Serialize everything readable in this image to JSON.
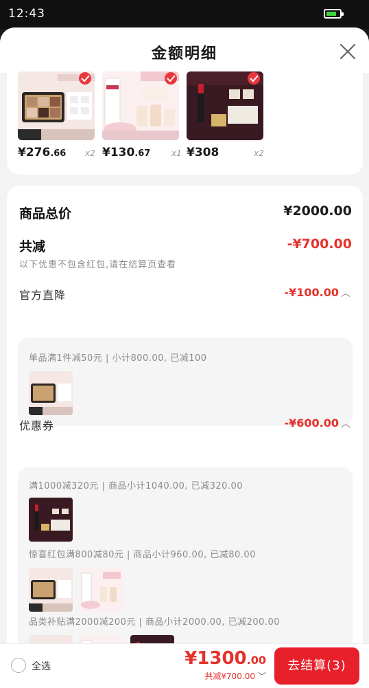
{
  "status_bar": {
    "time": "12:43",
    "battery_level": 0.8
  },
  "sheet": {
    "title": "金额明细"
  },
  "products": [
    {
      "price_main": "¥276",
      "price_dec": ".66",
      "qty": "x2"
    },
    {
      "price_main": "¥130",
      "price_dec": ".67",
      "qty": "x1"
    },
    {
      "price_main": "¥308",
      "price_dec": "",
      "qty": "x2"
    }
  ],
  "summary": {
    "total_label": "商品总价",
    "total_value": "¥2000.00",
    "discount_label": "共减",
    "discount_value": "-¥700.00",
    "discount_note": "以下优惠不包含红包,请在结算页查看"
  },
  "official": {
    "label": "官方直降",
    "value": "-¥100.00",
    "rule": "单品满1件减50元 | 小计800.00, 已减100"
  },
  "coupons": {
    "label": "优惠券",
    "value": "-¥600.00",
    "rules": [
      "满1000减320元 | 商品小计1040.00, 已减320.00",
      "惊喜红包满800减80元 | 商品小计960.00, 已减80.00",
      "品类补贴满2000减200元 | 商品小计2000.00, 已减200.00"
    ]
  },
  "bottom": {
    "select_all": "全选",
    "amount_main": "¥1300",
    "amount_dec": ".00",
    "discount_text": "共减¥700.00",
    "checkout_label": "去结算(3)"
  },
  "colors": {
    "accent": "#e5322d",
    "checkout": "#e8202a"
  },
  "icons": [
    "close-icon",
    "chevron-up-icon",
    "chevron-down-icon",
    "radio-icon",
    "battery-icon"
  ]
}
